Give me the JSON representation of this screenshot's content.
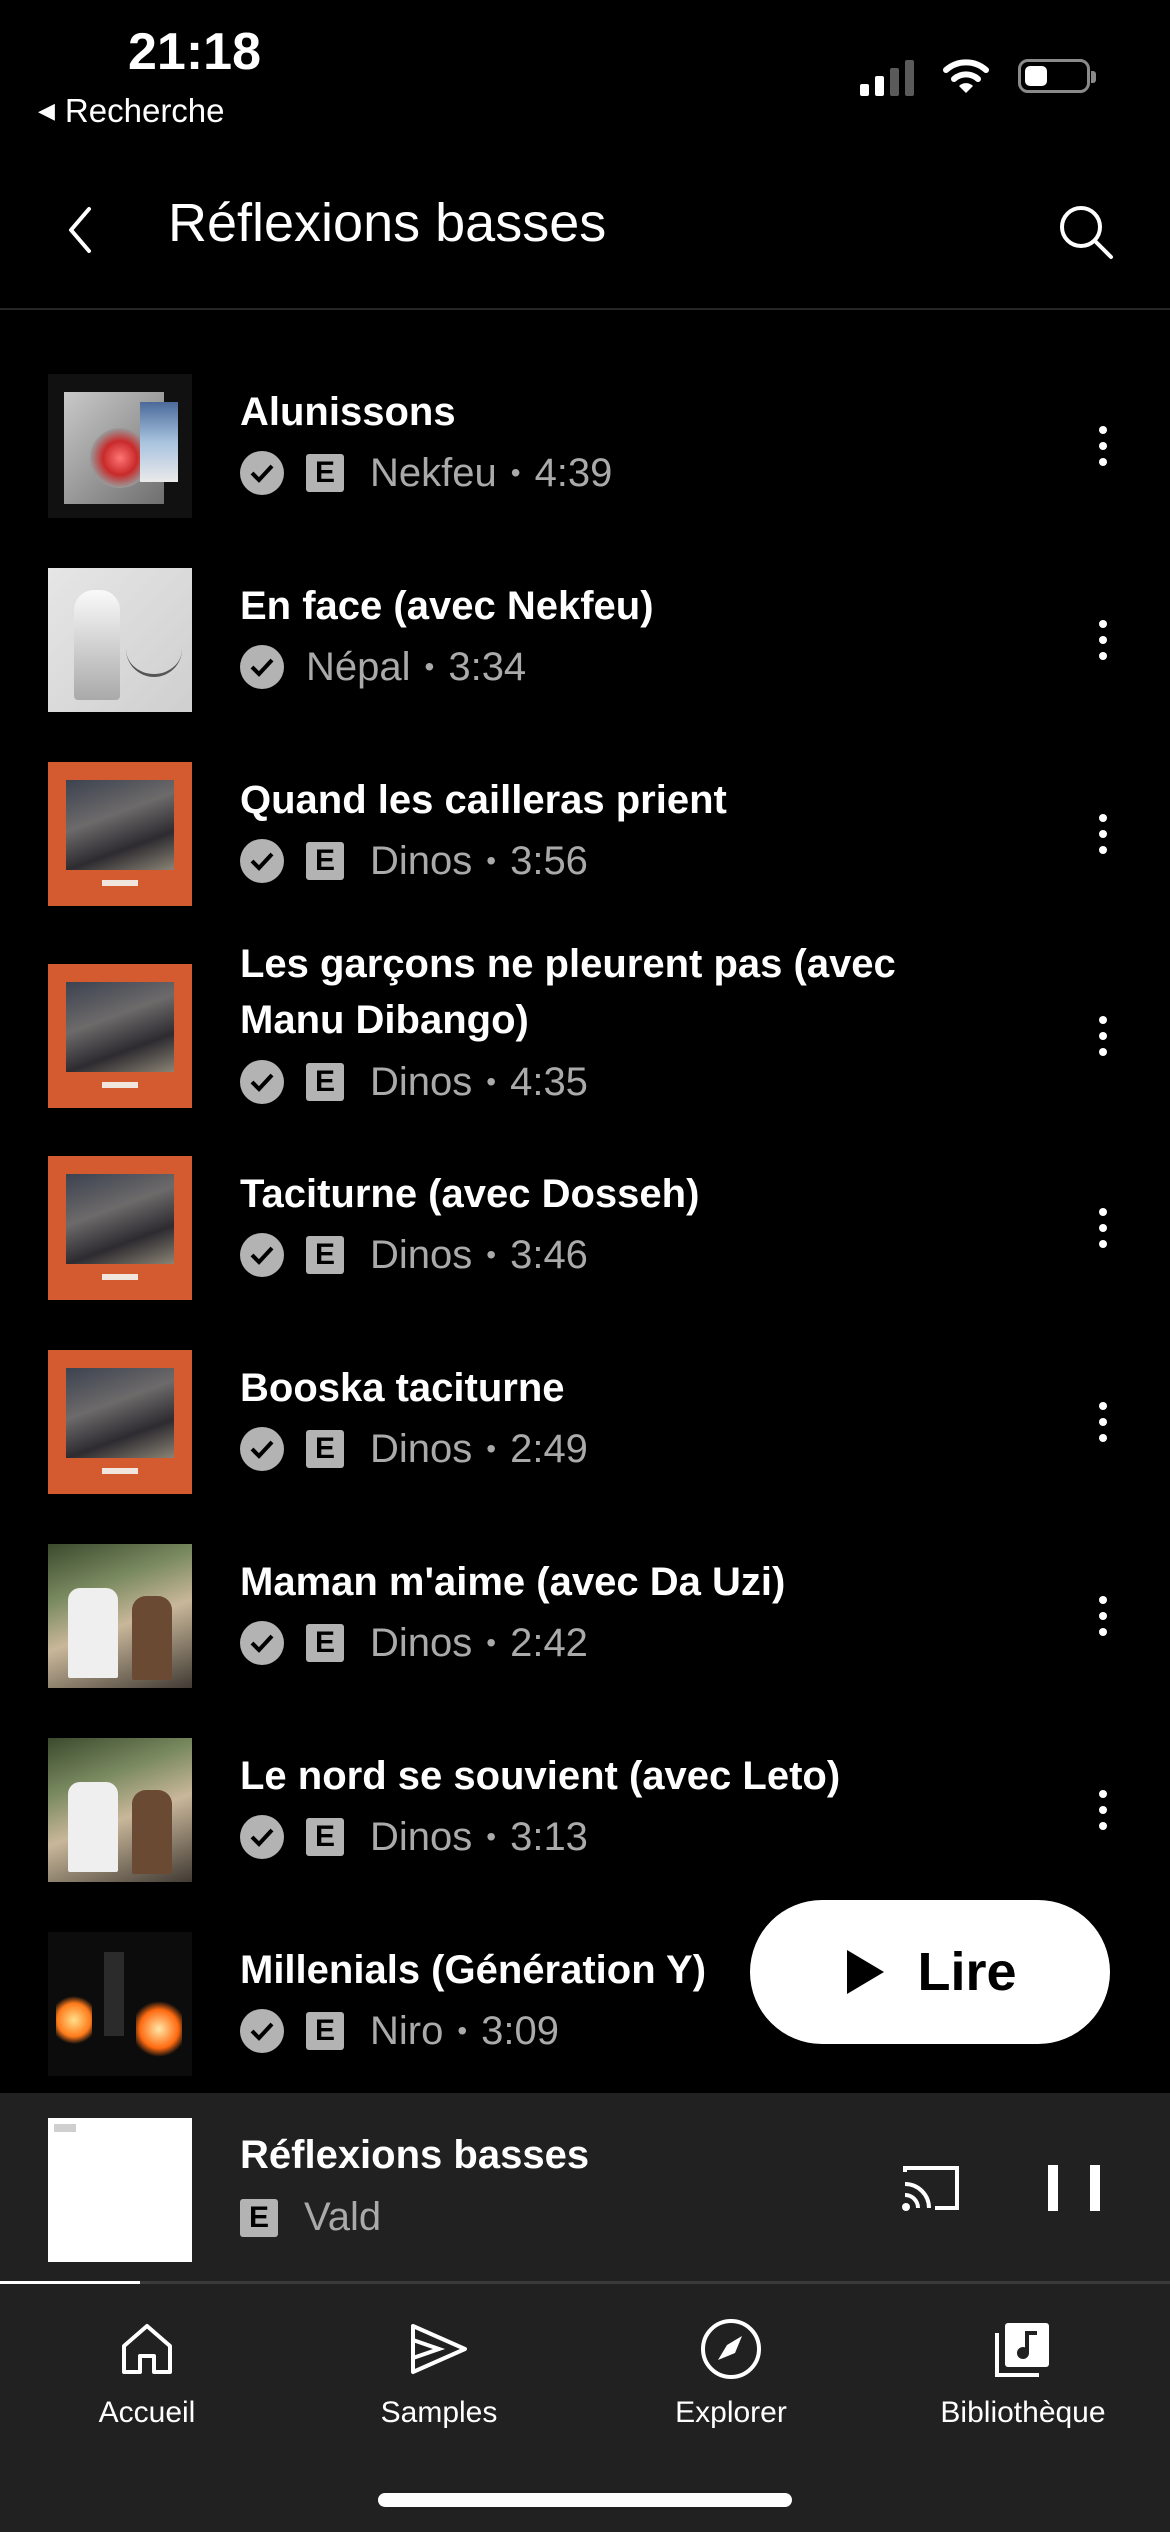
{
  "status_bar": {
    "time": "21:18",
    "back_app": "Recherche",
    "back_icon": "back-triangle-icon"
  },
  "header": {
    "title": "Réflexions basses",
    "back_icon": "chevron-left-icon",
    "search_icon": "search-icon"
  },
  "tracks": [
    {
      "title": "Alunissons",
      "explicit": true,
      "artist": "Nekfeu",
      "duration": "4:39"
    },
    {
      "title": "En face (avec Nekfeu)",
      "explicit": false,
      "artist": "Népal",
      "duration": "3:34"
    },
    {
      "title": "Quand les cailleras prient",
      "explicit": true,
      "artist": "Dinos",
      "duration": "3:56"
    },
    {
      "title_line1": "Les garçons ne pleurent pas (avec",
      "title_line2": "Manu Dibango)",
      "explicit": true,
      "artist": "Dinos",
      "duration": "4:35"
    },
    {
      "title": "Taciturne (avec Dosseh)",
      "explicit": true,
      "artist": "Dinos",
      "duration": "3:46"
    },
    {
      "title": "Booska taciturne",
      "explicit": true,
      "artist": "Dinos",
      "duration": "2:49"
    },
    {
      "title": "Maman m'aime (avec Da Uzi)",
      "explicit": true,
      "artist": "Dinos",
      "duration": "2:42"
    },
    {
      "title": "Le nord se souvient (avec Leto)",
      "explicit": true,
      "artist": "Dinos",
      "duration": "3:13"
    },
    {
      "title": "Millenials (Génération Y)",
      "explicit": true,
      "artist": "Niro",
      "duration": "3:09"
    }
  ],
  "badges": {
    "explicit": "E",
    "dot": "•"
  },
  "play_button": {
    "label": "Lire",
    "icon": "play-icon"
  },
  "mini_player": {
    "title": "Réflexions basses",
    "explicit": "E",
    "artist": "Vald",
    "progress": 0.12
  },
  "bottom_nav": [
    {
      "label": "Accueil",
      "icon": "home-icon"
    },
    {
      "label": "Samples",
      "icon": "samples-play-icon"
    },
    {
      "label": "Explorer",
      "icon": "compass-icon"
    },
    {
      "label": "Bibliothèque",
      "icon": "library-icon"
    }
  ],
  "colors": {
    "background": "#000000",
    "surface": "#212121",
    "secondary_text": "#aaaaaa",
    "badge": "#b3b3b3",
    "orange_cover": "#d45a30"
  }
}
